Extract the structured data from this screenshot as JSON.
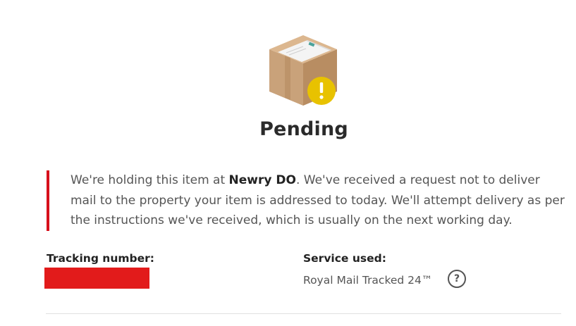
{
  "status": {
    "icon": "parcel-pending-icon",
    "title": "Pending",
    "accent_color": "#d7101c",
    "warning_color": "#e8c200"
  },
  "message": {
    "part1": "We're holding this item at ",
    "location": "Newry DO",
    "part2": ". We've received a request not to deliver mail to the property your item is addressed to today. We'll attempt delivery as per the instructions we've received, which is usually on the next working day."
  },
  "tracking": {
    "label": "Tracking number:"
  },
  "service": {
    "label": "Service used:",
    "value": "Royal Mail Tracked 24™",
    "help_icon": "?"
  }
}
